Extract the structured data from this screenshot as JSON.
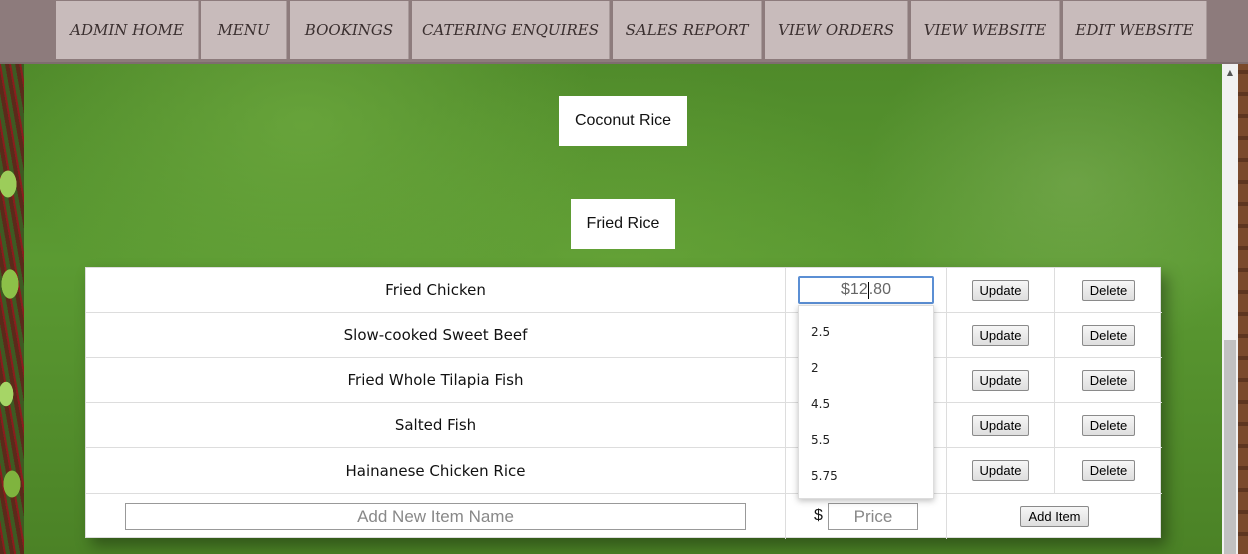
{
  "nav": {
    "items": [
      {
        "label": "ADMIN HOME"
      },
      {
        "label": "MENU"
      },
      {
        "label": "BOOKINGS"
      },
      {
        "label": "CATERING ENQUIRES"
      },
      {
        "label": "SALES REPORT"
      },
      {
        "label": "VIEW ORDERS"
      },
      {
        "label": "VIEW WEBSITE"
      },
      {
        "label": "EDIT WEBSITE"
      }
    ]
  },
  "categories": {
    "coconut_rice": "Coconut Rice",
    "fried_rice": "Fried Rice"
  },
  "table": {
    "rows": [
      {
        "name": "Fried Chicken",
        "update_label": "Update",
        "delete_label": "Delete"
      },
      {
        "name": "Slow-cooked Sweet Beef",
        "update_label": "Update",
        "delete_label": "Delete"
      },
      {
        "name": "Fried Whole Tilapia Fish",
        "update_label": "Update",
        "delete_label": "Delete"
      },
      {
        "name": "Salted Fish",
        "update_label": "Update",
        "delete_label": "Delete"
      },
      {
        "name": "Hainanese Chicken Rice",
        "update_label": "Update",
        "delete_label": "Delete"
      }
    ],
    "active_price": {
      "before_caret": "$12",
      "after_caret": ".80"
    },
    "add_row": {
      "name_placeholder": "Add New Item Name",
      "currency": "$",
      "price_placeholder": "Price",
      "add_label": "Add Item"
    }
  },
  "autocomplete": {
    "options": [
      "2.5",
      "2",
      "4.5",
      "5.5",
      "5.75"
    ]
  }
}
